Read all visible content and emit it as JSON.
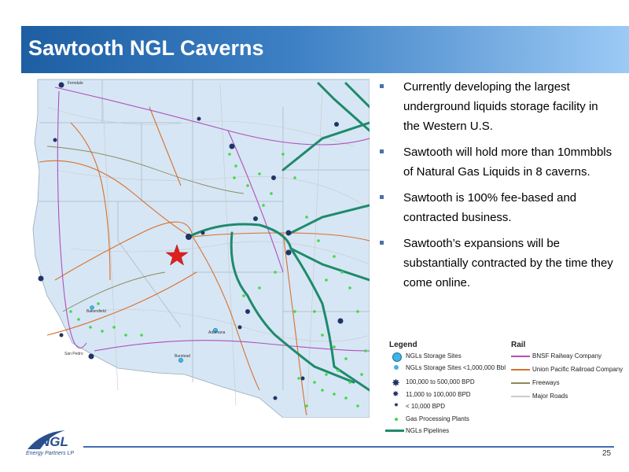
{
  "slide": {
    "title": "Sawtooth NGL Caverns",
    "page_number": "25"
  },
  "bullets": [
    "Currently developing the largest underground liquids storage facility in the Western U.S.",
    "Sawtooth will hold more than 10mmbbls of Natural Gas Liquids in 8 caverns.",
    "Sawtooth is 100% fee-based  and contracted business.",
    "Sawtooth’s expansions will be substantially contracted by the time they come online."
  ],
  "legend": {
    "title": "Legend",
    "items": [
      "NGLs Storage Sites",
      "NGLs Storage Sites <1,000,000 Bbl",
      "100,000 to  500,000 BPD",
      "11,000 to 100,000 BPD",
      "< 10,000 BPD",
      "Gas Processing Plants",
      "NGLs Pipelines"
    ]
  },
  "rail": {
    "title": "Rail",
    "items": [
      "BNSF Railway Company",
      "Union Pacific Railroad Company",
      "Freeways",
      "Major Roads"
    ]
  },
  "map": {
    "labels": [
      "Ferndale",
      "Bakersfield",
      "San Pedro",
      "Adamana",
      "Burstead"
    ]
  },
  "logo": {
    "text": "NGL",
    "subtitle": "Energy Partners LP"
  },
  "colors": {
    "title_bar_start": "#1e5fa4",
    "title_bar_end": "#9ccaf5",
    "pipeline": "#1f8a6b",
    "bnsf": "#b050b8",
    "union_pacific": "#d9702a",
    "freeway": "#8a8a5a",
    "gas_plant": "#44d844",
    "storage_site": "#3cb6e8",
    "sawtooth_star": "#e02020"
  }
}
